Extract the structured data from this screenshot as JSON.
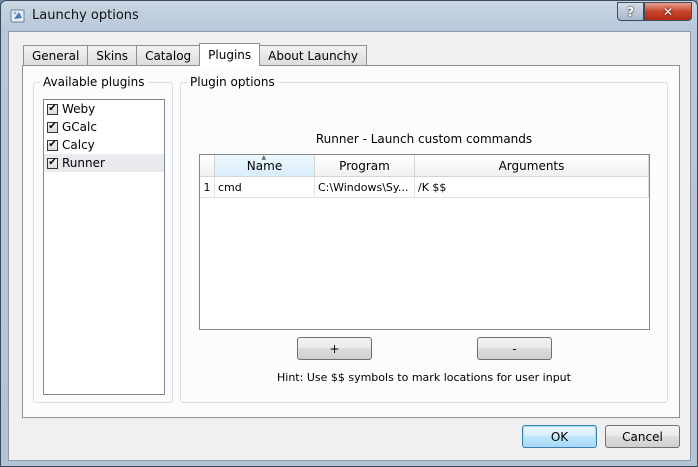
{
  "window": {
    "title": "Launchy options",
    "help_label": "?",
    "close_label": "✕"
  },
  "tabs": [
    {
      "label": "General"
    },
    {
      "label": "Skins"
    },
    {
      "label": "Catalog"
    },
    {
      "label": "Plugins",
      "active": true
    },
    {
      "label": "About Launchy"
    }
  ],
  "available_plugins": {
    "title": "Available plugins",
    "items": [
      {
        "label": "Weby",
        "checked": true
      },
      {
        "label": "GCalc",
        "checked": true
      },
      {
        "label": "Calcy",
        "checked": true
      },
      {
        "label": "Runner",
        "checked": true,
        "selected": true
      }
    ]
  },
  "plugin_options": {
    "title": "Plugin options",
    "heading": "Runner - Launch custom commands",
    "columns": [
      "Name",
      "Program",
      "Arguments"
    ],
    "rows": [
      {
        "num": "1",
        "name": "cmd",
        "program": "C:\\Windows\\Sy...",
        "arguments": "/K $$"
      }
    ],
    "add_label": "+",
    "remove_label": "-",
    "hint": "Hint: Use $$ symbols to mark locations for user input"
  },
  "footer": {
    "ok_label": "OK",
    "cancel_label": "Cancel"
  }
}
